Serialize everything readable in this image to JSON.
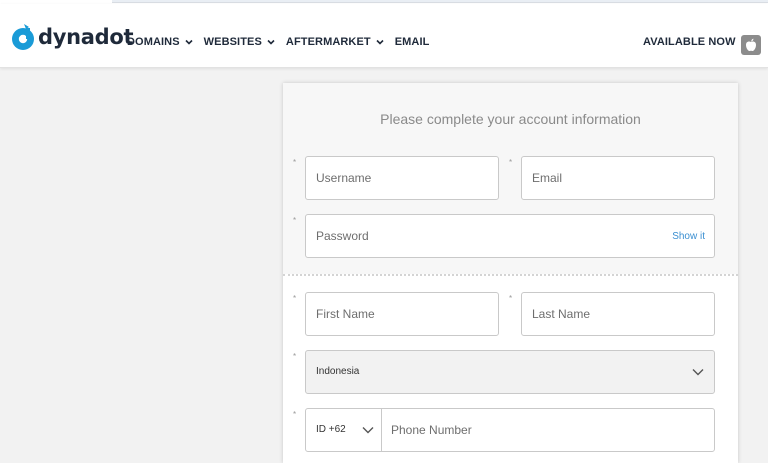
{
  "header": {
    "logo_text": "dynadot",
    "nav": [
      {
        "label": "DOMAINS",
        "dropdown": true
      },
      {
        "label": "WEBSITES",
        "dropdown": true
      },
      {
        "label": "AFTERMARKET",
        "dropdown": true
      },
      {
        "label": "EMAIL",
        "dropdown": false
      }
    ],
    "available_label": "AVAILABLE NOW",
    "app_icon": "apple-icon"
  },
  "form": {
    "title": "Please complete your account information",
    "required_marker": "*",
    "username": {
      "placeholder": "Username",
      "value": ""
    },
    "email": {
      "placeholder": "Email",
      "value": ""
    },
    "password": {
      "placeholder": "Password",
      "value": "",
      "show_label": "Show it"
    },
    "first_name": {
      "placeholder": "First Name",
      "value": ""
    },
    "last_name": {
      "placeholder": "Last Name",
      "value": ""
    },
    "country": {
      "value": "Indonesia"
    },
    "phone": {
      "code": "ID +62",
      "placeholder": "Phone Number",
      "value": ""
    }
  },
  "colors": {
    "brand_blue": "#1a9bd7",
    "brand_dark": "#1f2a3a",
    "link": "#3b8fd1"
  }
}
